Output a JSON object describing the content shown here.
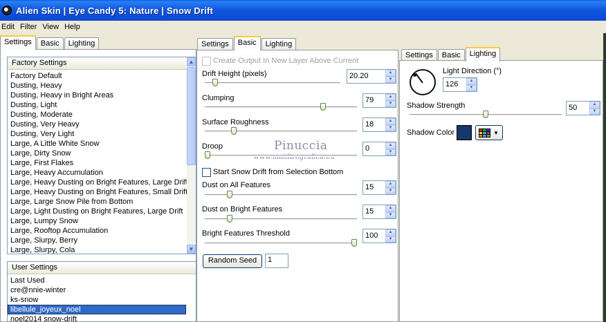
{
  "window": {
    "title": "Alien Skin  |  Eye Candy 5: Nature  |  Snow Drift"
  },
  "menu": [
    "Edit",
    "Filter",
    "View",
    "Help"
  ],
  "left_tabs": [
    "Settings",
    "Basic",
    "Lighting"
  ],
  "factory": {
    "header": "Factory Settings",
    "items": [
      "Factory Default",
      "Dusting, Heavy",
      "Dusting, Heavy in Bright Areas",
      "Dusting, Light",
      "Dusting, Moderate",
      "Dusting, Very Heavy",
      "Dusting, Very Light",
      "Large, A Little White Snow",
      "Large, Dirty Snow",
      "Large, First Flakes",
      "Large, Heavy Accumulation",
      "Large, Heavy Dusting on Bright Features, Large Drift",
      "Large, Heavy Dusting on Bright Features, Small Drift",
      "Large, Large Snow Pile from Bottom",
      "Large, Light Dusting on Bright Features, Large Drift",
      "Large, Lumpy Snow",
      "Large, Rooftop Accumulation",
      "Large, Slurpy, Berry",
      "Large, Slurpy, Cola"
    ]
  },
  "user": {
    "header": "User Settings",
    "items": [
      "Last Used",
      "cre@nnie-winter",
      "ks-snow",
      "libellule_joyeux_noel",
      "noel2014  snow-drift"
    ],
    "selected_index": 3
  },
  "basic_tabs": [
    "Settings",
    "Basic",
    "Lighting"
  ],
  "basic": {
    "create_output_label": "Create Output In New Layer Above Current",
    "drift_height": {
      "label": "Drift Height (pixels)",
      "value": "20.20",
      "level": 0.06
    },
    "clumping": {
      "label": "Clumping",
      "value": "79",
      "level": 0.79
    },
    "surface_roughness": {
      "label": "Surface Roughness",
      "value": "18",
      "level": 0.18
    },
    "droop": {
      "label": "Droop",
      "value": "0",
      "level": 0.0
    },
    "start_from_selection_label": "Start Snow Drift from Selection Bottom",
    "dust_all": {
      "label": "Dust on All Features",
      "value": "15",
      "level": 0.15
    },
    "dust_bright": {
      "label": "Dust on Bright Features",
      "value": "15",
      "level": 0.15
    },
    "bright_threshold": {
      "label": "Bright Features Threshold",
      "value": "100",
      "level": 1.0
    },
    "random_seed_label": "Random Seed",
    "random_seed_value": "1"
  },
  "watermark": {
    "line1": "Pinuccia",
    "line2": "www.maidiregrafica.eu"
  },
  "lighting_tabs": [
    "Settings",
    "Basic",
    "Lighting"
  ],
  "lighting": {
    "direction_label": "Light Direction (°)",
    "direction_value": "126",
    "shadow_strength_label": "Shadow Strength",
    "shadow_strength_value": "50",
    "shadow_strength_level": 0.5,
    "shadow_color_label": "Shadow Color",
    "shadow_color": "#17376b"
  }
}
